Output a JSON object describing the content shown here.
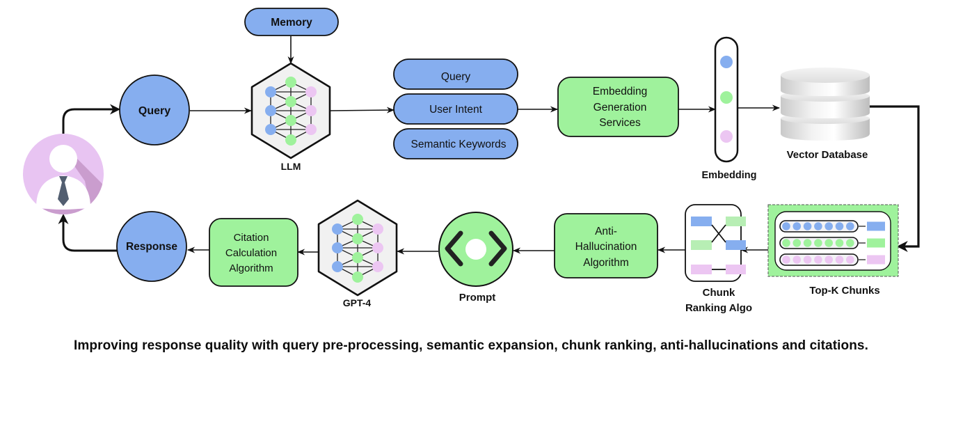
{
  "colors": {
    "blue": "#86aeef",
    "green": "#9ff29c",
    "pink": "#ecc6f2",
    "hex_bg": "#f1f1f1",
    "user_avatar": "#e8c4f2",
    "user_shadow": "#c497c8",
    "tie": "#525e70",
    "stroke": "#111111"
  },
  "nodes": {
    "user": {
      "name": "User"
    },
    "memory": {
      "label": "Memory"
    },
    "query_circle": {
      "label": "Query"
    },
    "llm": {
      "label": "LLM"
    },
    "preprocess": {
      "items": [
        {
          "label": "Query"
        },
        {
          "label": "User Intent"
        },
        {
          "label": "Semantic Keywords"
        }
      ]
    },
    "embedding_service": {
      "lines": [
        "Embedding",
        "Generation",
        "Services"
      ]
    },
    "embedding": {
      "label": "Embedding"
    },
    "vector_db": {
      "label": "Vector Database"
    },
    "top_k": {
      "label": "Top-K Chunks",
      "rows": 3,
      "dots_per_row": 7
    },
    "chunk_ranking": {
      "lines": [
        "Chunk",
        "Ranking Algo"
      ]
    },
    "anti_hallucination": {
      "lines": [
        "Anti-",
        "Hallucination",
        "Algorithm"
      ]
    },
    "prompt": {
      "label": "Prompt"
    },
    "gpt4": {
      "label": "GPT-4"
    },
    "citation": {
      "lines": [
        "Citation",
        "Calculation",
        "Algorithm"
      ]
    },
    "response_circle": {
      "label": "Response"
    }
  },
  "caption": "Improving response quality with query pre-processing, semantic expansion, chunk ranking, anti-hallucinations and citations."
}
